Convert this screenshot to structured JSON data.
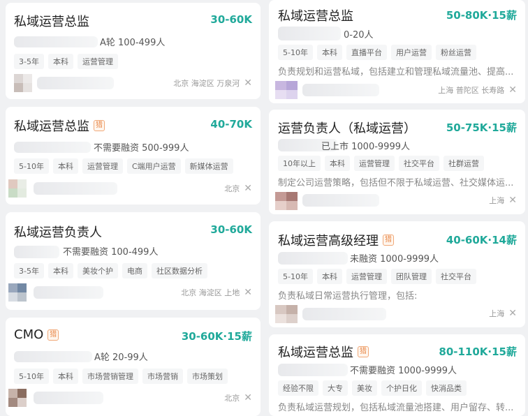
{
  "jobs": [
    {
      "title": "私域运营总监",
      "salary": "30-60K",
      "company": "A轮 100-499人",
      "tags": [
        "3-5年",
        "本科",
        "运营管理"
      ],
      "location": "北京 海淀区 万泉河",
      "recruiter_tag": ""
    },
    {
      "title": "私域运营总监",
      "salary": "40-70K",
      "company": "不需要融资 500-999人",
      "tags": [
        "5-10年",
        "本科",
        "运营管理",
        "C端用户运营",
        "新媒体运营"
      ],
      "location": "北京",
      "recruiter_tag": "猎"
    },
    {
      "title": "私域运营负责人",
      "salary": "30-60K",
      "company": "不需要融资 100-499人",
      "tags": [
        "3-5年",
        "本科",
        "美妆个护",
        "电商",
        "社区数据分析"
      ],
      "location": "北京 海淀区 上地",
      "recruiter_tag": ""
    },
    {
      "title": "CMO",
      "salary": "30-60K·15薪",
      "company": "A轮 20-99人",
      "tags": [
        "5-10年",
        "本科",
        "市场营销管理",
        "市场营销",
        "市场策划"
      ],
      "location": "北京",
      "recruiter_tag": "猎"
    },
    {
      "title": "私域运营总监",
      "salary": "50-80K·15薪",
      "company": "0-20人",
      "tags": [
        "5-10年",
        "本科",
        "直播平台",
        "用户运营",
        "粉丝运营"
      ],
      "description": "负责规划和运营私域，包括建立和管理私域流量池、提高...",
      "location": "上海 普陀区 长寿路",
      "recruiter_tag": ""
    },
    {
      "title": "运营负责人（私域运营）",
      "salary": "50-75K·15薪",
      "company": "已上市 1000-9999人",
      "tags": [
        "10年以上",
        "本科",
        "运营管理",
        "社交平台",
        "社群运营"
      ],
      "description": "制定公司运营策略，包括但不限于私域运营、社交媒体运...",
      "location": "上海",
      "recruiter_tag": ""
    },
    {
      "title": "私域运营高级经理",
      "salary": "40-60K·14薪",
      "company": "未融资 1000-9999人",
      "tags": [
        "5-10年",
        "本科",
        "运营管理",
        "团队管理",
        "社交平台"
      ],
      "description": "负责私域日常运营执行管理，包括:",
      "location": "上海",
      "recruiter_tag": "猎"
    },
    {
      "title": "私域运营总监",
      "salary": "80-110K·15薪",
      "company": "不需要融资 1000-9999人",
      "tags": [
        "经验不限",
        "大专",
        "美妆",
        "个护日化",
        "快消品类"
      ],
      "description": "负责私域运营规划，包括私域流量池搭建、用户留存、转...",
      "location": "",
      "recruiter_tag": "猎"
    }
  ],
  "close_glyph": "✕"
}
